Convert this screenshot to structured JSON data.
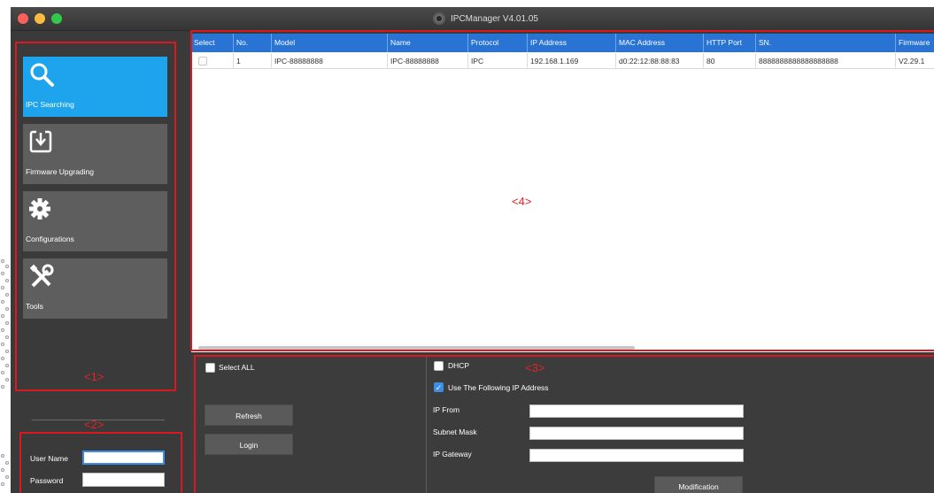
{
  "window": {
    "title": "IPCManager V4.01.05"
  },
  "sidebar": {
    "items": [
      {
        "label": "IPC Searching",
        "icon": "search-icon",
        "active": true
      },
      {
        "label": "Firmware Upgrading",
        "icon": "download-tray-icon",
        "active": false
      },
      {
        "label": "Configurations",
        "icon": "gear-icon",
        "active": false
      },
      {
        "label": "Tools",
        "icon": "tools-icon",
        "active": false
      }
    ]
  },
  "login": {
    "username_label": "User Name",
    "password_label": "Password",
    "username_value": "",
    "password_value": ""
  },
  "table": {
    "columns": [
      "Select",
      "No.",
      "Model",
      "Name",
      "Protocol",
      "IP Address",
      "MAC Address",
      "HTTP Port",
      "SN.",
      "Firmware"
    ],
    "rows": [
      {
        "select": false,
        "no": "1",
        "model": "IPC-88888888",
        "name": "IPC-88888888",
        "protocol": "IPC",
        "ip": "192.168.1.169",
        "mac": "d0:22:12:88:88:83",
        "http_port": "80",
        "sn": "8888888888888888888",
        "firmware": "V2.29.1"
      }
    ]
  },
  "controls": {
    "select_all_label": "Select ALL",
    "refresh_label": "Refresh",
    "login_label": "Login",
    "dhcp_label": "DHCP",
    "use_following_label": "Use The Following IP Address",
    "use_following_checked": true,
    "ip_from_label": "IP From",
    "subnet_mask_label": "Subnet Mask",
    "ip_gateway_label": "IP Gateway",
    "ip_from_value": "",
    "subnet_mask_value": "",
    "ip_gateway_value": "",
    "modification_label": "Modification"
  },
  "annotations": {
    "label_1": "<1>",
    "label_2": "<2>",
    "label_3": "<3>",
    "label_4": "<4>"
  },
  "colors": {
    "header_blue": "#2873d4",
    "active_nav": "#1ea4ec",
    "annotation_red": "#d9191f"
  }
}
